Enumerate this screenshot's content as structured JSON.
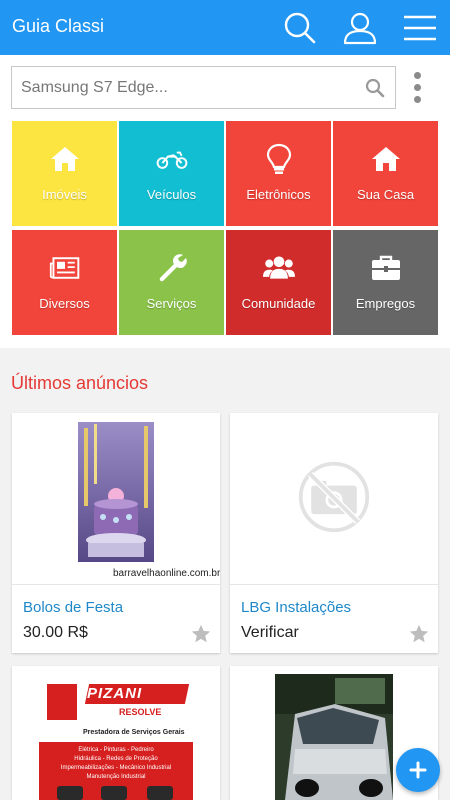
{
  "app": {
    "title": "Guia Classi"
  },
  "search": {
    "placeholder": "Samsung S7 Edge..."
  },
  "icons": {
    "search": "search-icon",
    "user": "user-icon",
    "menu": "hamburger-menu-icon",
    "more": "more-vert-icon",
    "favorite": "star-icon",
    "add": "plus-icon"
  },
  "colors": {
    "appbar": "#2196f3",
    "section_title": "#e53935",
    "link": "#1e88c8"
  },
  "categories": [
    {
      "label": "Imóveis",
      "icon": "home-icon",
      "color": "#ffeb3b"
    },
    {
      "label": "Veículos",
      "icon": "motorcycle-icon",
      "color": "#00bcd4"
    },
    {
      "label": "Eletrônicos",
      "icon": "lightbulb-icon",
      "color": "#f44336"
    },
    {
      "label": "Sua Casa",
      "icon": "home-icon",
      "color": "#f44336"
    },
    {
      "label": "Diversos",
      "icon": "newspaper-icon",
      "color": "#f44336"
    },
    {
      "label": "Serviços",
      "icon": "wrench-icon",
      "color": "#8bc34a"
    },
    {
      "label": "Comunidade",
      "icon": "users-icon",
      "color": "#d32f2f"
    },
    {
      "label": "Empregos",
      "icon": "briefcase-icon",
      "color": "#666666"
    }
  ],
  "latest": {
    "title": "Últimos anúncios",
    "ads": [
      {
        "title": "Bolos de Festa",
        "price": "30.00 R$",
        "image_caption": "barravelhaonline.com.br"
      },
      {
        "title": "LBG Instalações",
        "price": "Verificar",
        "image_caption": ""
      },
      {
        "title": "",
        "price": "",
        "image_text": {
          "brand": "PIZANI",
          "brand_sub": "RESOLVE",
          "tagline": "Prestadora de Serviços Gerais",
          "services_1": "Elétrica - Pinturas - Pedreiro",
          "services_2": "Hidráulica - Redes de Proteção",
          "services_3": "Impermeabilizações - Mecânico Industrial",
          "services_4": "Manutenção Industrial"
        }
      },
      {
        "title": "",
        "price": ""
      }
    ]
  }
}
